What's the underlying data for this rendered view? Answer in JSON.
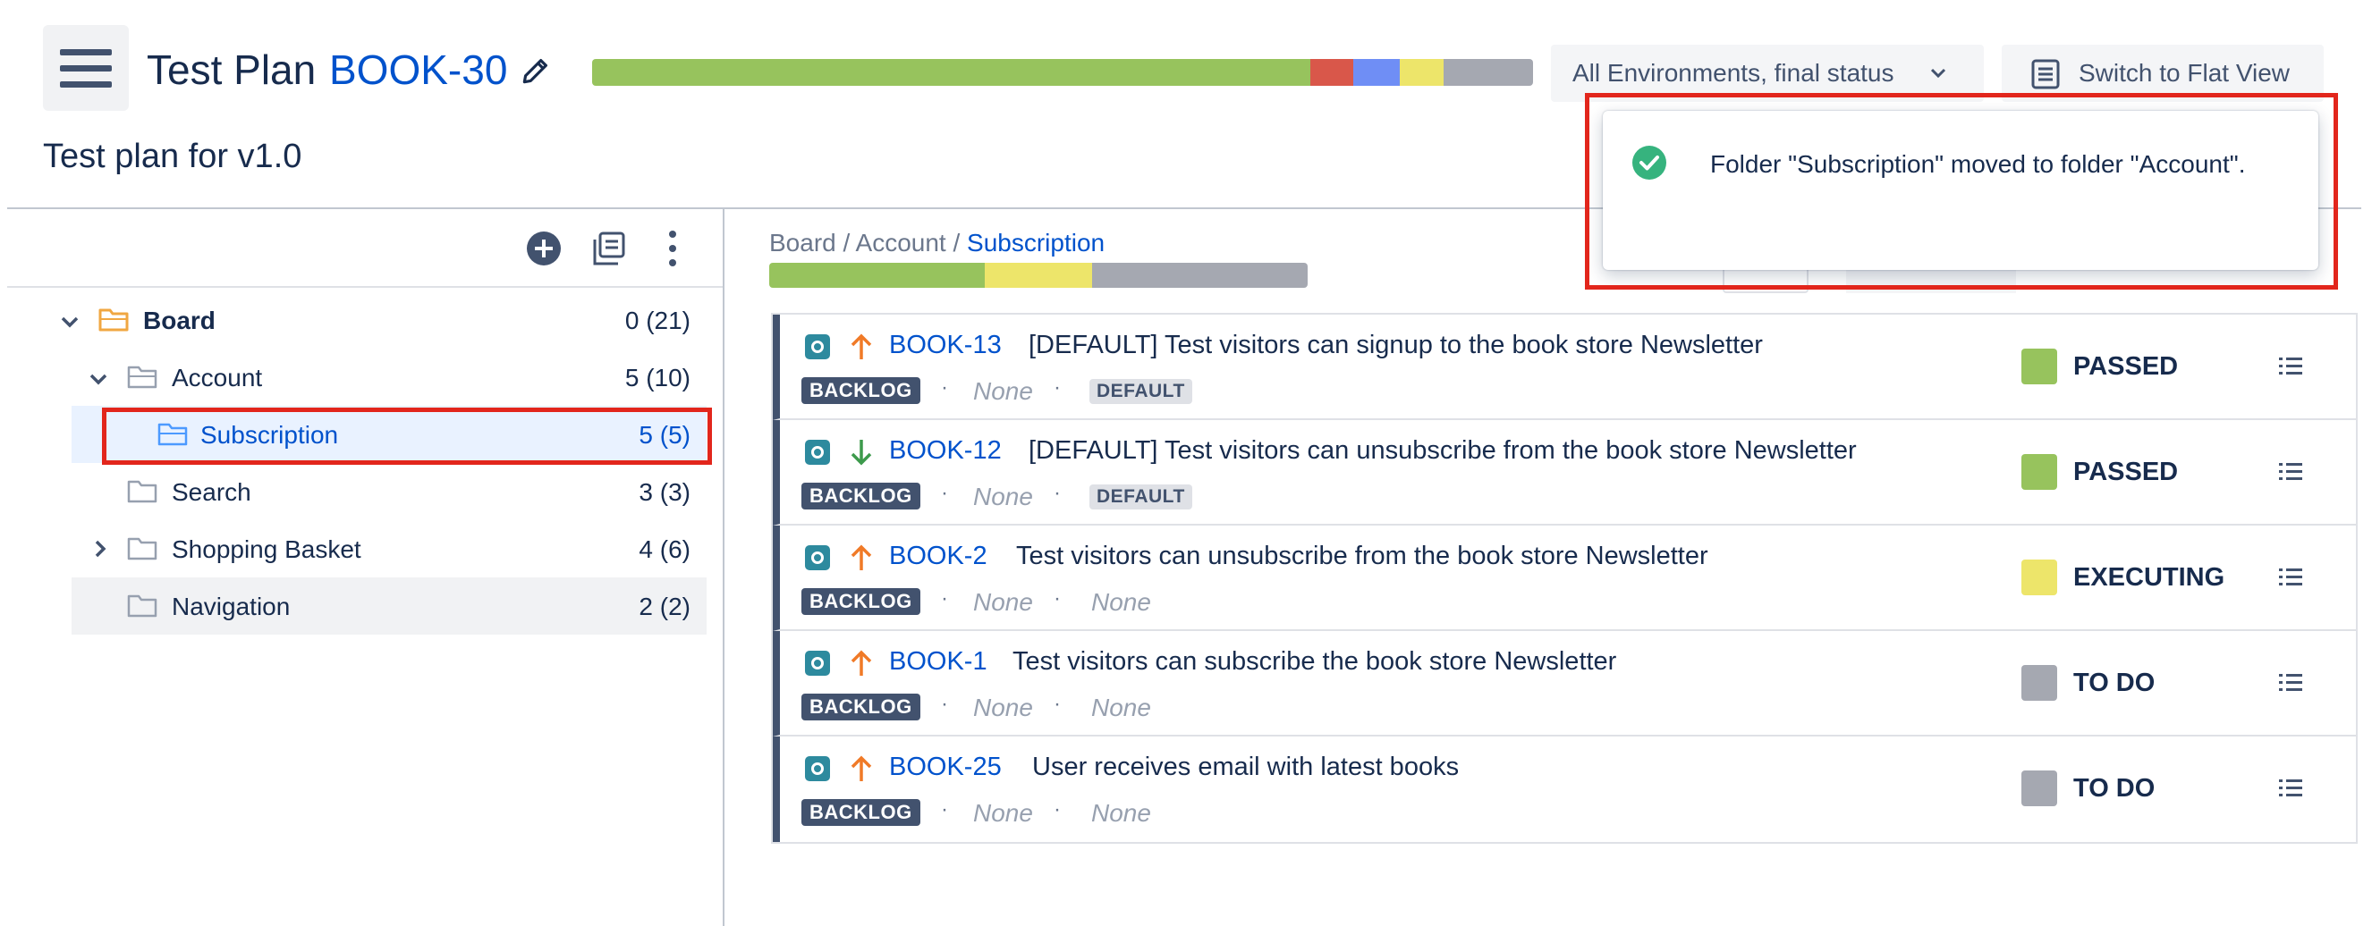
{
  "header": {
    "title": "Test Plan",
    "key": "BOOK-30",
    "subtitle": "Test plan for v1.0",
    "environment_select": "All Environments, final status",
    "flat_view_label": "Switch to Flat View",
    "progress": [
      {
        "status": "PASSED",
        "color": "#97c35d",
        "fraction": 0.763
      },
      {
        "status": "FAILED",
        "color": "#d9574a",
        "fraction": 0.046
      },
      {
        "status": "TO DO (blue)",
        "color": "#6f8ef5",
        "fraction": 0.049
      },
      {
        "status": "EXECUTING",
        "color": "#ede56a",
        "fraction": 0.047
      },
      {
        "status": "TO DO",
        "color": "#a5a8b1",
        "fraction": 0.095
      }
    ]
  },
  "tree": {
    "items": [
      {
        "name": "Board",
        "count": "0 (21)",
        "expanded": true
      },
      {
        "name": "Account",
        "count": "5 (10)",
        "expanded": true
      },
      {
        "name": "Subscription",
        "count": "5 (5)",
        "selected": true
      },
      {
        "name": "Search",
        "count": "3 (3)"
      },
      {
        "name": "Shopping Basket",
        "count": "4 (6)",
        "expanded": false
      },
      {
        "name": "Navigation",
        "count": "2 (2)"
      }
    ]
  },
  "breadcrumb": {
    "parts": [
      "Board",
      "Account"
    ],
    "separator": " / ",
    "current": "Subscription"
  },
  "folder_progress": [
    {
      "color": "#97c35d",
      "fraction": 0.4
    },
    {
      "color": "#ede56a",
      "fraction": 0.2
    },
    {
      "color": "#a5a8b1",
      "fraction": 0.4
    }
  ],
  "tests": [
    {
      "key": "BOOK-13",
      "summary": "[DEFAULT] Test visitors can signup to the book store Newsletter",
      "priority": "up",
      "status_label": "BACKLOG",
      "field1": "None",
      "field2": "DEFAULT",
      "execution_status": "PASSED",
      "status_color": "#97c35d"
    },
    {
      "key": "BOOK-12",
      "summary": "[DEFAULT] Test visitors can unsubscribe from the book store Newsletter",
      "priority": "down",
      "status_label": "BACKLOG",
      "field1": "None",
      "field2": "DEFAULT",
      "execution_status": "PASSED",
      "status_color": "#97c35d"
    },
    {
      "key": "BOOK-2",
      "summary": "Test visitors can unsubscribe from the book store Newsletter",
      "priority": "up",
      "status_label": "BACKLOG",
      "field1": "None",
      "field2": "None",
      "execution_status": "EXECUTING",
      "status_color": "#ede56a"
    },
    {
      "key": "BOOK-1",
      "summary": "Test visitors can subscribe the book store Newsletter",
      "priority": "up",
      "status_label": "BACKLOG",
      "field1": "None",
      "field2": "None",
      "execution_status": "TO DO",
      "status_color": "#a5a8b1"
    },
    {
      "key": "BOOK-25",
      "summary": "User receives email with latest books",
      "priority": "up",
      "status_label": "BACKLOG",
      "field1": "None",
      "field2": "None",
      "execution_status": "TO DO",
      "status_color": "#a5a8b1"
    }
  ],
  "toast": {
    "message": "Folder \"Subscription\" moved to folder \"Account\"."
  },
  "colors": {
    "link": "#0052cc",
    "highlight": "#e2261c",
    "priority_up": "#f07a27",
    "priority_down": "#3d9a4c"
  }
}
